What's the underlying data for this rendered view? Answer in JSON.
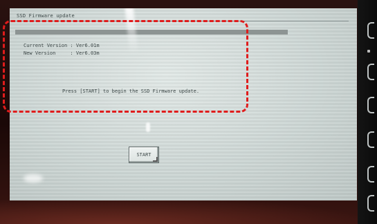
{
  "window": {
    "title": "SSD Firmware update"
  },
  "versions": {
    "current_label": "Current Version",
    "current_value": "Ver6.01m",
    "new_label": "New Version",
    "new_value": "Ver6.03m"
  },
  "message": "Press [START] to begin the SSD Firmware update.",
  "start_button": {
    "label": "START"
  },
  "colors": {
    "screen_background": "#d3dcda",
    "text": "#3b4646",
    "header_bar": "#8d9493",
    "highlight": "#e01c1c"
  }
}
